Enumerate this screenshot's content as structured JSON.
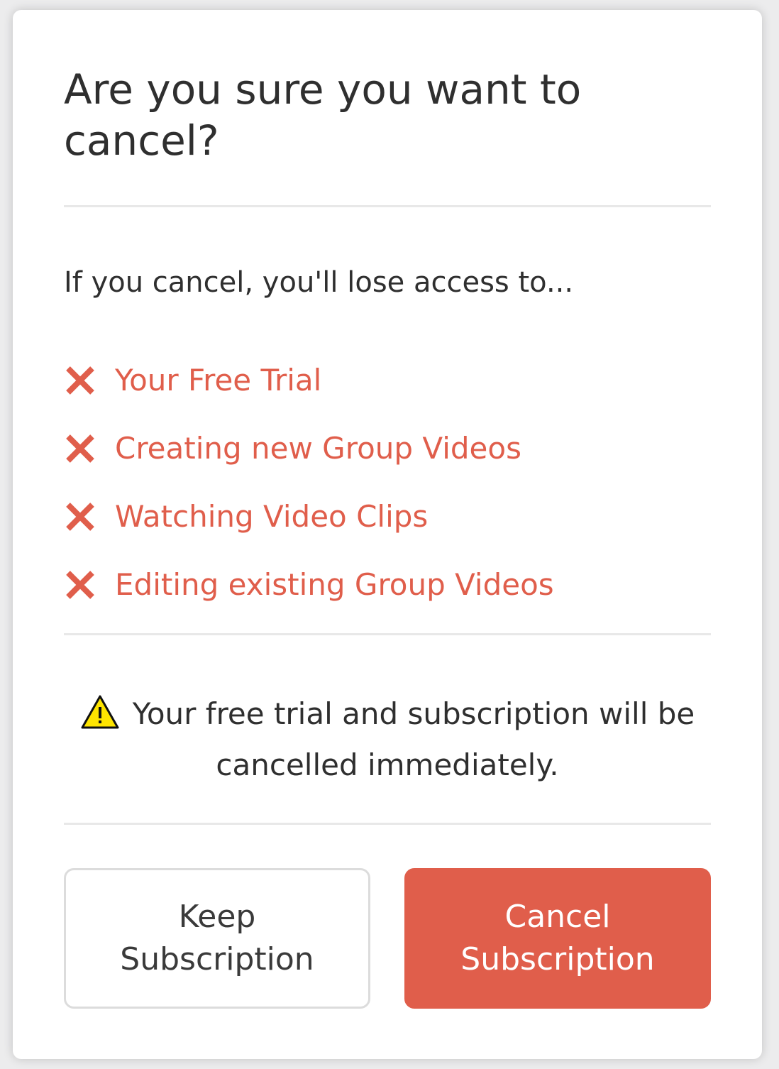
{
  "colors": {
    "accent": "#e05e4b",
    "text": "#2f2f2f",
    "divider": "#e8e8e8",
    "warning_yellow": "#ffe500"
  },
  "dialog": {
    "title": "Are you sure you want to cancel?",
    "intro": "If you cancel, you'll lose access to...",
    "loss_items": [
      {
        "icon": "x-mark-icon",
        "label": "Your Free Trial"
      },
      {
        "icon": "x-mark-icon",
        "label": "Creating new Group Videos"
      },
      {
        "icon": "x-mark-icon",
        "label": "Watching Video Clips"
      },
      {
        "icon": "x-mark-icon",
        "label": "Editing existing Group Videos"
      }
    ],
    "warning": {
      "icon": "warning-triangle-icon",
      "text": "Your free trial and subscription will be cancelled immediately."
    },
    "buttons": {
      "keep_label": "Keep Subscription",
      "cancel_label": "Cancel Subscription"
    }
  }
}
